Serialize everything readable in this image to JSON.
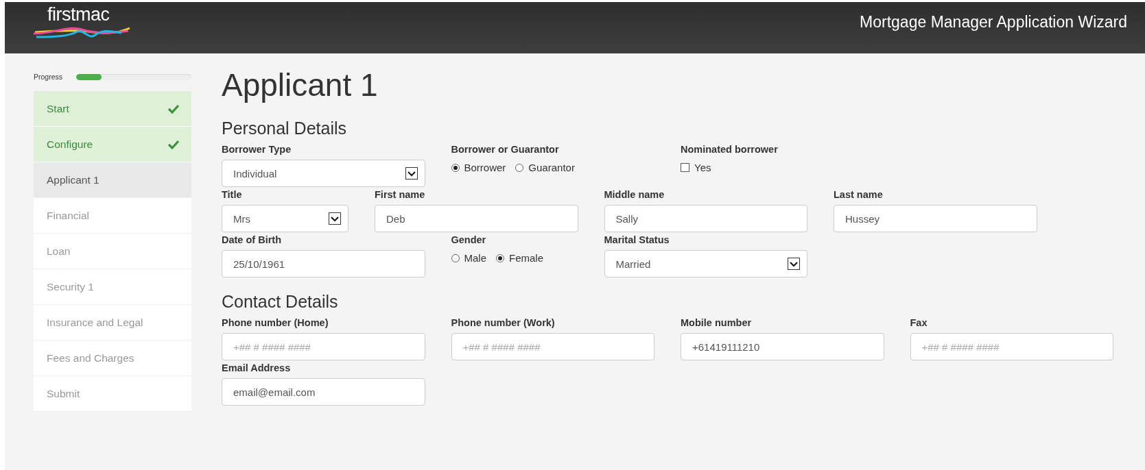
{
  "header": {
    "logo": "firstmac",
    "title": "Mortgage Manager Application Wizard"
  },
  "sidebar": {
    "progress": {
      "label": "Progress",
      "level": 0.22
    },
    "items": [
      {
        "label": "Start",
        "completed": true,
        "selected": false
      },
      {
        "label": "Configure",
        "completed": true,
        "selected": false
      },
      {
        "label": "Applicant 1",
        "completed": false,
        "selected": true
      },
      {
        "label": "Financial",
        "completed": false,
        "selected": false
      },
      {
        "label": "Loan",
        "completed": false,
        "selected": false
      },
      {
        "label": "Security 1",
        "completed": false,
        "selected": false
      },
      {
        "label": "Insurance and Legal",
        "completed": false,
        "selected": false
      },
      {
        "label": "Fees and Charges",
        "completed": false,
        "selected": false
      },
      {
        "label": "Submit",
        "completed": false,
        "selected": false
      }
    ]
  },
  "page_title": "Applicant 1",
  "sections": [
    {
      "title": "Personal Details",
      "rows": [
        [
          {
            "label": "Borrower Type",
            "kind": "select",
            "value": "Individual"
          },
          {
            "label": "Borrower or Guarantor",
            "kind": "radio",
            "options": [
              {
                "label": "Borrower",
                "selected": true
              },
              {
                "label": "Guarantor",
                "selected": false
              }
            ]
          },
          {
            "label": "Nominated borrower",
            "kind": "checkbox",
            "option": "Yes",
            "checked": false
          }
        ],
        [
          {
            "label": "Title",
            "kind": "select",
            "value": "Mrs"
          },
          {
            "label": "First name",
            "kind": "text",
            "value": "Deb"
          },
          {
            "label": "Middle name",
            "kind": "text",
            "value": "Sally"
          },
          {
            "label": "Last name",
            "kind": "text",
            "value": "Hussey"
          }
        ],
        [
          {
            "label": "Date of Birth",
            "kind": "text",
            "value": "25/10/1961"
          },
          {
            "label": "Gender",
            "kind": "radio",
            "options": [
              {
                "label": "Male",
                "selected": false
              },
              {
                "label": "Female",
                "selected": true
              }
            ]
          },
          {
            "label": "Marital Status",
            "kind": "select",
            "value": "Married"
          }
        ]
      ]
    },
    {
      "title": "Contact Details",
      "rows": [
        [
          {
            "label": "Phone number (Home)",
            "kind": "text",
            "placeholder": "+## # #### ####"
          },
          {
            "label": "Phone number (Work)",
            "kind": "text",
            "placeholder": "+## # #### ####"
          },
          {
            "label": "Mobile number",
            "kind": "text",
            "value": "+61419111210"
          },
          {
            "label": "Fax",
            "kind": "text",
            "placeholder": "+## # #### ####"
          }
        ],
        [
          {
            "label": "Email Address",
            "kind": "text",
            "value": "email@email.com"
          }
        ]
      ]
    }
  ]
}
